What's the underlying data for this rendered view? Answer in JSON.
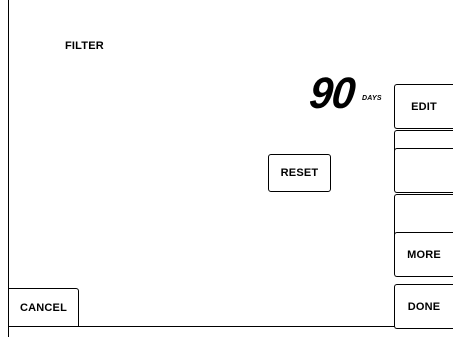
{
  "screen": {
    "title": "FILTER",
    "value": "90",
    "unit": "DAYS"
  },
  "buttons": {
    "reset": "RESET",
    "cancel": "CANCEL",
    "edit": "EDIT",
    "blank_1": "",
    "blank_2": "",
    "blank_3": "",
    "more": "MORE",
    "done": "DONE"
  }
}
